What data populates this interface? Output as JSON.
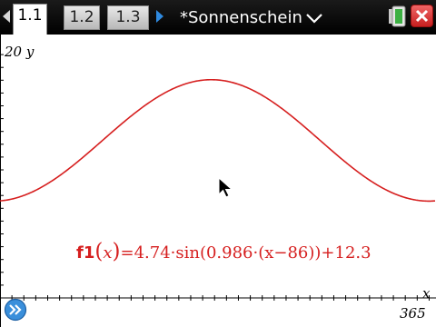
{
  "tabs": [
    {
      "label": "1.1",
      "active": true
    },
    {
      "label": "1.2",
      "active": false
    },
    {
      "label": "1.3",
      "active": false
    }
  ],
  "document": {
    "title": "*Sonnenschein"
  },
  "graph": {
    "y_axis_label": "20",
    "y_axis_var": "y",
    "x_axis_var": "x",
    "x_axis_max_label": "365",
    "window": {
      "xmin": 0,
      "xmax": 365,
      "ymin": 0,
      "ymax": 20
    },
    "function": {
      "name": "f1",
      "var": "x",
      "text": "=4.74·sin(0.986·(x−86))+12.3",
      "amplitude": 4.74,
      "frequency_deg": 0.986,
      "phase_shift": 86,
      "offset": 12.3,
      "color": "#d61f1f"
    }
  },
  "colors": {
    "accent": "#2f8ae0",
    "close": "#d62828",
    "battery": "#3cb043"
  }
}
